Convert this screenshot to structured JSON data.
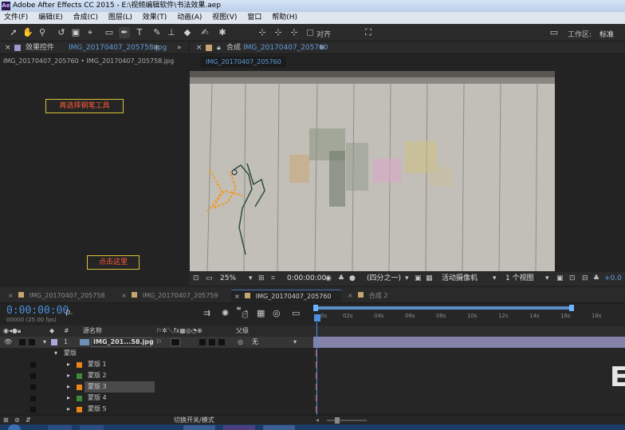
{
  "window": {
    "app_badge": "Ae",
    "title": "Adobe After Effects CC 2015 - E:\\视频编辑软件\\书法效果.aep"
  },
  "menu": [
    "文件(F)",
    "编辑(E)",
    "合成(C)",
    "图层(L)",
    "效果(T)",
    "动画(A)",
    "视图(V)",
    "窗口",
    "帮助(H)"
  ],
  "toolbar": {
    "snap_label": "对齐",
    "workspace_label": "工作区:",
    "workspace_value": "标准"
  },
  "effects_panel": {
    "tab_prefix": "效果控件",
    "tab_file": "IMG_20170407_205758.jpg",
    "breadcrumb": "IMG_20170407_205760 • IMG_20170407_205758.jpg"
  },
  "comp_panel": {
    "tab_prefix": "合成",
    "tab_name": "IMG_20170407_205760",
    "sub_tab": "IMG_20170407_205760",
    "zoom": "25%",
    "timecode": "0:00:00:00",
    "resolution": "(四分之一)",
    "camera": "活动摄像机",
    "views": "1 个视图",
    "exposure": "+0.0"
  },
  "annotations": {
    "pen_tool": "再选择钢笔工具",
    "click_here": "点击这里"
  },
  "timeline": {
    "tabs": [
      "IMG_20170407_205758",
      "IMG_20170407_205759",
      "IMG_20170407_205760",
      "合成 2"
    ],
    "timecode": "0:00:00:00",
    "fps": "00000 (25.00 fps)",
    "search_icon": "ρ.",
    "col_source": "源名称",
    "col_parent": "父级",
    "layer": {
      "num": "1",
      "name": "IMG_201...58.jpg",
      "parent": "无"
    },
    "masks_group": "蒙版",
    "masks": [
      {
        "name": "蒙版 1",
        "color": "#e8861a"
      },
      {
        "name": "蒙版 2",
        "color": "#3f8a3a"
      },
      {
        "name": "蒙版 3",
        "color": "#e8861a"
      },
      {
        "name": "蒙版 4",
        "color": "#3f8a3a"
      },
      {
        "name": "蒙版 5",
        "color": "#e8861a"
      }
    ],
    "ruler": [
      "0s",
      "02s",
      "04s",
      "06s",
      "08s",
      "10s",
      "12s",
      "14s",
      "16s",
      "18s"
    ],
    "toggle_label": "切换开关/模式"
  }
}
